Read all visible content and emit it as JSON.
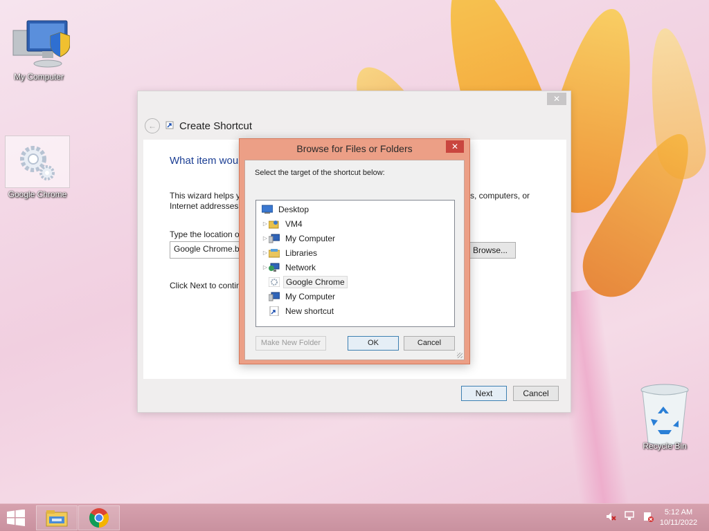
{
  "desktop": {
    "icons": [
      {
        "label": "My Computer"
      },
      {
        "label": "Google Chrome"
      },
      {
        "label": "Recycle Bin"
      }
    ]
  },
  "wizard": {
    "title": "Create Shortcut",
    "close_glyph": "✕",
    "heading": "What item wou",
    "description_left": "This wizard helps y",
    "description_right": "s, computers, or",
    "description_line2": "Internet addresses.",
    "location_label": "Type the location o",
    "location_value": "Google Chrome.b",
    "browse_label": "Browse...",
    "next_hint": "Click Next to contin",
    "next_label": "Next",
    "cancel_label": "Cancel"
  },
  "browse_dialog": {
    "title": "Browse for Files or Folders",
    "close_glyph": "✕",
    "instruction": "Select the target of the shortcut below:",
    "tree": [
      {
        "label": "Desktop",
        "expandable": false,
        "icon": "desktop-icon"
      },
      {
        "label": "VM4",
        "expandable": true,
        "icon": "user-folder-icon"
      },
      {
        "label": "My Computer",
        "expandable": true,
        "icon": "computer-icon"
      },
      {
        "label": "Libraries",
        "expandable": true,
        "icon": "libraries-icon"
      },
      {
        "label": "Network",
        "expandable": true,
        "icon": "network-icon"
      },
      {
        "label": "Google Chrome",
        "expandable": false,
        "icon": "shortcut-gear-icon",
        "selected": true
      },
      {
        "label": "My Computer",
        "expandable": false,
        "icon": "computer-icon"
      },
      {
        "label": "New shortcut",
        "expandable": false,
        "icon": "shortcut-icon"
      }
    ],
    "make_folder_label": "Make New Folder",
    "ok_label": "OK",
    "cancel_label": "Cancel"
  },
  "taskbar": {
    "time": "5:12 AM",
    "date": "10/11/2022"
  }
}
